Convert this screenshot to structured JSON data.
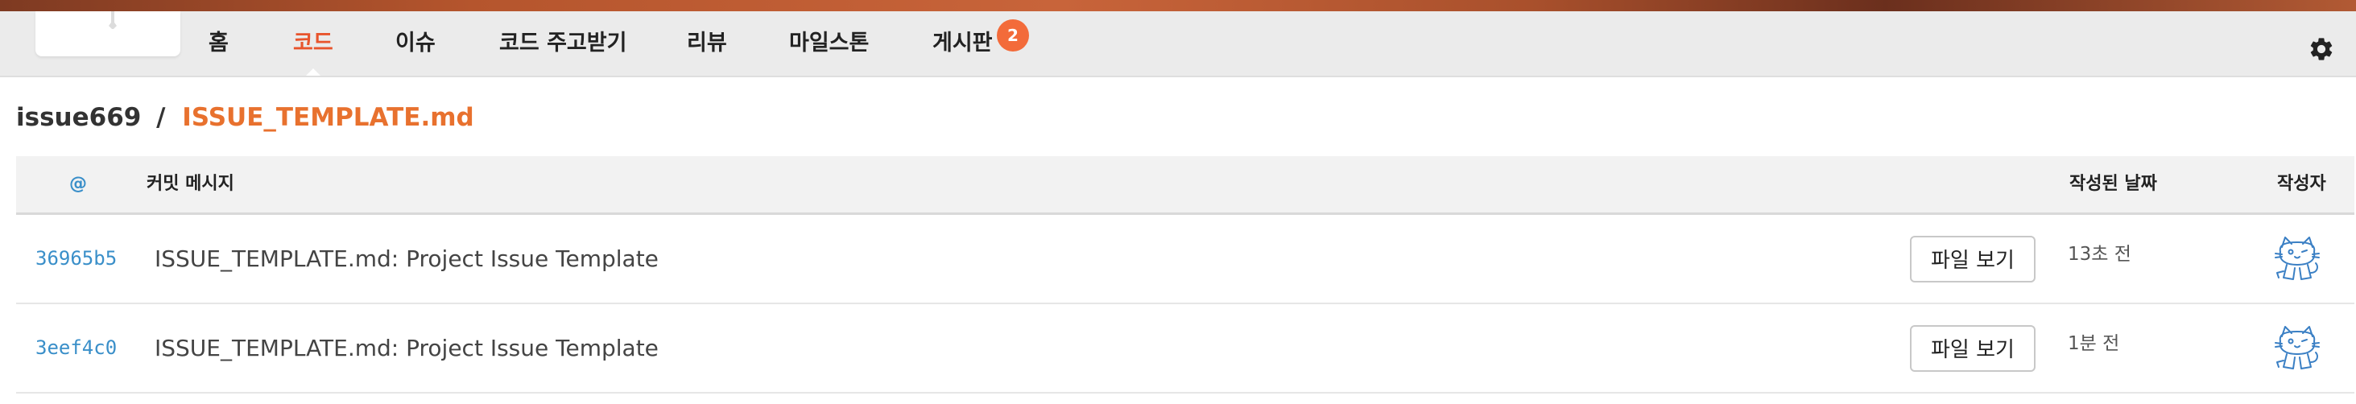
{
  "nav": {
    "items": [
      {
        "label": "홈",
        "active": false
      },
      {
        "label": "코드",
        "active": true
      },
      {
        "label": "이슈",
        "active": false
      },
      {
        "label": "코드 주고받기",
        "active": false
      },
      {
        "label": "리뷰",
        "active": false
      },
      {
        "label": "마일스톤",
        "active": false
      },
      {
        "label": "게시판",
        "active": false
      }
    ],
    "board_badge": "2",
    "settings_icon": "gear-icon"
  },
  "breadcrumb": {
    "repo": "issue669",
    "separator": "/",
    "file": "ISSUE_TEMPLATE.md"
  },
  "table": {
    "headers": {
      "sha": "@",
      "message": "커밋 메시지",
      "date": "작성된 날짜",
      "author": "작성자"
    },
    "rows": [
      {
        "sha": "36965b5",
        "message": "ISSUE_TEMPLATE.md: Project Issue Template",
        "view_button": "파일 보기",
        "date": "13초 전",
        "avatar_icon": "cat-avatar-icon"
      },
      {
        "sha": "3eef4c0",
        "message": "ISSUE_TEMPLATE.md: Project Issue Template",
        "view_button": "파일 보기",
        "date": "1분 전",
        "avatar_icon": "cat-avatar-icon"
      }
    ]
  },
  "colors": {
    "accent": "#e8542c",
    "file_link": "#e8712e",
    "sha_link": "#3a8fc9",
    "badge": "#f36b3a"
  }
}
